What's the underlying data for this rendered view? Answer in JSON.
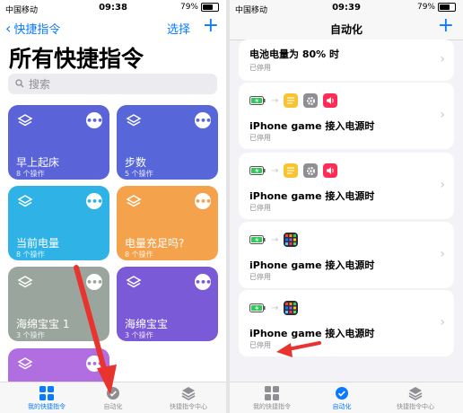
{
  "left": {
    "status": {
      "carrier": "中国移动",
      "time": "09:38",
      "battery": "79%",
      "battery_level": 0.79
    },
    "nav": {
      "back_label": "快捷指令",
      "select_label": "选择",
      "add_label": "+"
    },
    "title": "所有快捷指令",
    "search": {
      "placeholder": "搜索"
    },
    "cards": [
      {
        "title": "早上起床",
        "subtitle": "8 个操作",
        "color": "#5a63d8"
      },
      {
        "title": "步数",
        "subtitle": "5 个操作",
        "color": "#5766d8"
      },
      {
        "title": "当前电量",
        "subtitle": "8 个操作",
        "color": "#2fb3e6"
      },
      {
        "title": "电量充足吗?",
        "subtitle": "8 个操作",
        "color": "#f4a24b"
      },
      {
        "title": "海绵宝宝 1",
        "subtitle": "3 个操作",
        "color": "#9aa59e"
      },
      {
        "title": "海绵宝宝",
        "subtitle": "3 个操作",
        "color": "#7a5ad6"
      },
      {
        "title": "",
        "subtitle": "",
        "color": "#b06ee0"
      }
    ],
    "tabs": [
      {
        "label": "我的快捷指令",
        "icon": "grid-icon"
      },
      {
        "label": "自动化",
        "icon": "clock-check-icon"
      },
      {
        "label": "快捷指令中心",
        "icon": "layers-icon"
      }
    ]
  },
  "right": {
    "status": {
      "carrier": "中国移动",
      "time": "09:39",
      "battery": "79%",
      "battery_level": 0.79
    },
    "title": "自动化",
    "add_label": "+",
    "automations": [
      {
        "title": "电池电量为 80% 时",
        "status": "已停用"
      },
      {
        "title": "iPhone game 接入电源时",
        "status": "已停用",
        "icons": [
          "battery-charging",
          "notes",
          "settings",
          "sound"
        ]
      },
      {
        "title": "iPhone game 接入电源时",
        "status": "已停用",
        "icons": [
          "battery-charging",
          "notes",
          "settings",
          "sound"
        ]
      },
      {
        "title": "iPhone game 接入电源时",
        "status": "已停用",
        "icons": [
          "battery-charging",
          "shortcuts-grid"
        ]
      },
      {
        "title": "iPhone game 接入电源时",
        "status": "已停用",
        "icons": [
          "battery-charging",
          "shortcuts-grid"
        ]
      }
    ],
    "tabs": [
      {
        "label": "我的快捷指令",
        "icon": "grid-icon"
      },
      {
        "label": "自动化",
        "icon": "clock-check-icon"
      },
      {
        "label": "快捷指令中心",
        "icon": "layers-icon"
      }
    ]
  },
  "colors": {
    "accent": "#0a7aff",
    "annotation": "#e8332e"
  }
}
